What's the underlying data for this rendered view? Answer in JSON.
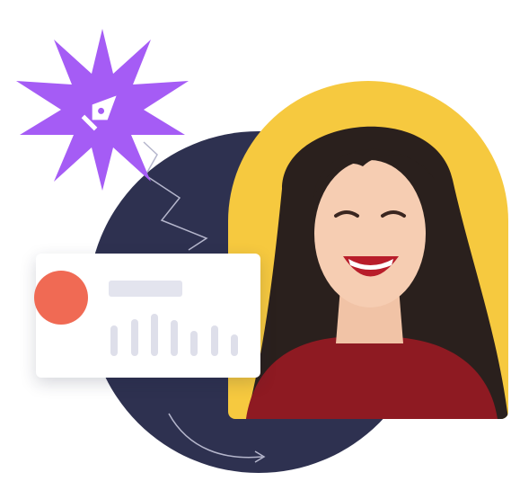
{
  "colors": {
    "circle": "#2e3150",
    "arch": "#f6c93f",
    "accent_dot": "#f06a54",
    "placeholder": "#e3e4ee",
    "bars": "#dedfea",
    "star": "#a55cf5",
    "line": "#b5b6cc"
  },
  "icons": {
    "star": "pen-tool-icon",
    "arrow": "curved-arrow-icon"
  },
  "image": {
    "subject": "person-photo"
  }
}
